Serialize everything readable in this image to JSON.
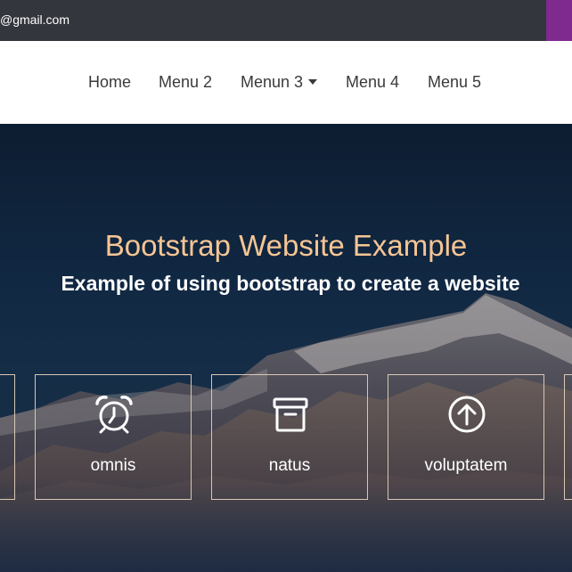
{
  "topbar": {
    "email_text": "@gmail.com",
    "accent_color": "#7e2a8e"
  },
  "nav": {
    "items": [
      {
        "label": "Home"
      },
      {
        "label": "Menu 2"
      },
      {
        "label": "Menun 3",
        "has_dropdown": true
      },
      {
        "label": "Menu 4"
      },
      {
        "label": "Menu 5"
      }
    ]
  },
  "hero": {
    "title": "Bootstrap Website Example",
    "subtitle": "Example of using bootstrap to create a website",
    "title_color": "#f6c594"
  },
  "features": [
    {
      "label": "omnis",
      "icon": "alarm-clock-icon"
    },
    {
      "label": "natus",
      "icon": "archive-box-icon"
    },
    {
      "label": "voluptatem",
      "icon": "arrow-up-circle-icon"
    }
  ]
}
